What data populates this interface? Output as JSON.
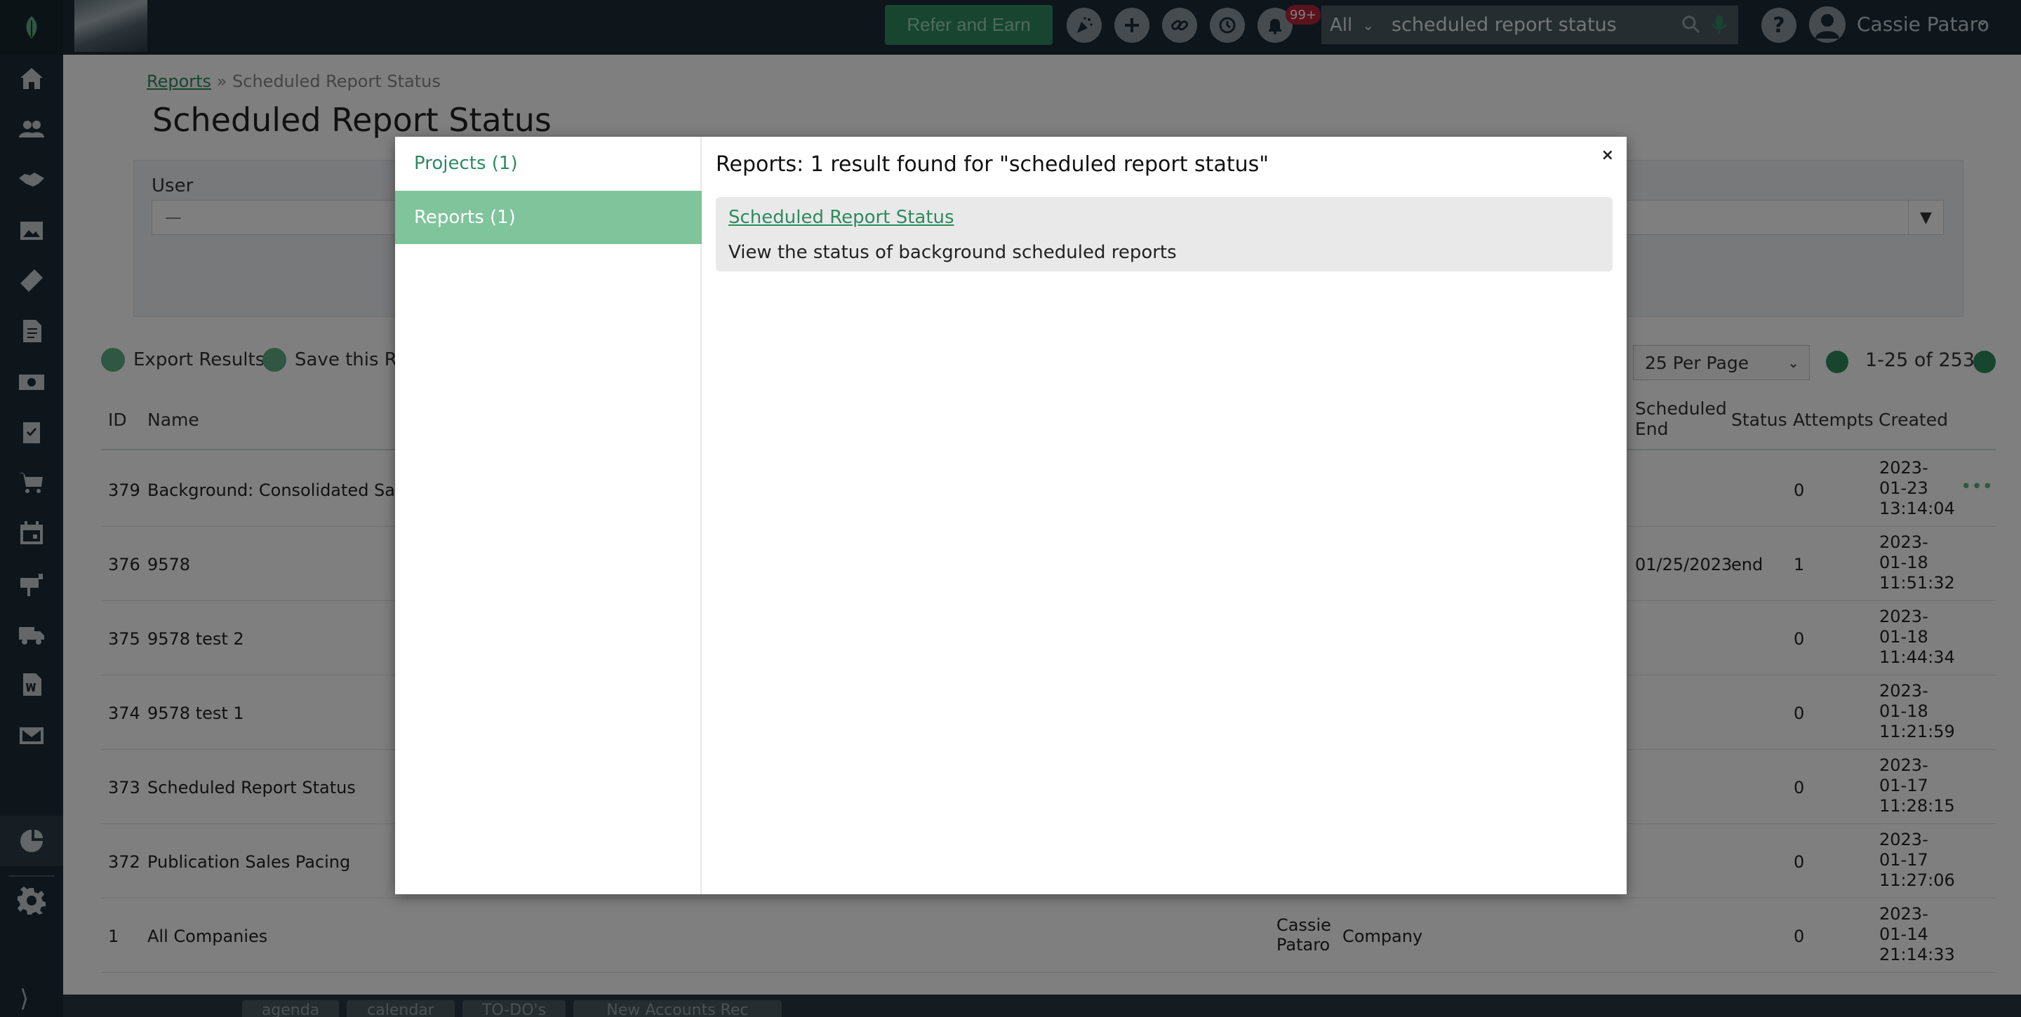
{
  "topbar": {
    "refer_label": "Refer and Earn",
    "notif_count": "99+",
    "search_scope": "All",
    "search_value": "scheduled report status",
    "user_name": "Cassie Pataro",
    "help_label": "?"
  },
  "page": {
    "breadcrumb_link": "Reports",
    "breadcrumb_sep": "»",
    "breadcrumb_current": "Scheduled Report Status",
    "title": "Scheduled Report Status",
    "filter_user_label": "User",
    "filter_user_value": "—",
    "export_label": "Export Results",
    "save_label": "Save this Re",
    "per_page": "25 Per Page",
    "page_count": "1-25 of 253"
  },
  "table": {
    "headers": {
      "id": "ID",
      "name": "Name",
      "scheduled_end_1": "Scheduled",
      "scheduled_end_2": "End",
      "status": "Status",
      "attempts": "Attempts",
      "created": "Created"
    },
    "rows": [
      {
        "id": "379",
        "name": "Background: Consolidated Sales",
        "owner": "",
        "type": "",
        "sched_end": "",
        "status": "",
        "attempts": "0",
        "created": "2023-\n01-23\n13:14:04"
      },
      {
        "id": "376",
        "name": "9578",
        "owner": "",
        "type": "",
        "sched_end": "01/25/2023",
        "status": "end",
        "attempts": "1",
        "created": "2023-\n01-18\n11:51:32"
      },
      {
        "id": "375",
        "name": "9578 test 2",
        "owner": "",
        "type": "",
        "sched_end": "",
        "status": "",
        "attempts": "0",
        "created": "2023-\n01-18\n11:44:34"
      },
      {
        "id": "374",
        "name": "9578 test 1",
        "owner": "",
        "type": "",
        "sched_end": "",
        "status": "",
        "attempts": "0",
        "created": "2023-\n01-18\n11:21:59"
      },
      {
        "id": "373",
        "name": "Scheduled Report Status",
        "owner": "",
        "type": "",
        "sched_end": "",
        "status": "",
        "attempts": "0",
        "created": "2023-\n01-17\n11:28:15"
      },
      {
        "id": "372",
        "name": "Publication Sales Pacing",
        "owner": "",
        "type": "",
        "sched_end": "",
        "status": "",
        "attempts": "0",
        "created": "2023-\n01-17\n11:27:06"
      },
      {
        "id": "1",
        "name": "All Companies",
        "owner": "Cassie\nPataro",
        "type": "Company",
        "sched_end": "",
        "status": "",
        "attempts": "0",
        "created": "2023-\n01-14\n21:14:33"
      }
    ],
    "row_more_label": "•••"
  },
  "modal": {
    "tabs": [
      {
        "label": "Projects (1)"
      },
      {
        "label": "Reports (1)"
      }
    ],
    "heading": "Reports: 1 result found for \"scheduled report status\"",
    "close_label": "×",
    "result_title": "Scheduled Report Status",
    "result_desc": "View the status of background scheduled reports"
  },
  "bottombar": {
    "tabs": [
      "agenda",
      "calendar",
      "TO-DO's",
      "New Accounts Rec"
    ]
  },
  "colors": {
    "brand_green": "#2e8a61",
    "active_tab": "#7fc49b",
    "navy": "#1d2d38"
  }
}
